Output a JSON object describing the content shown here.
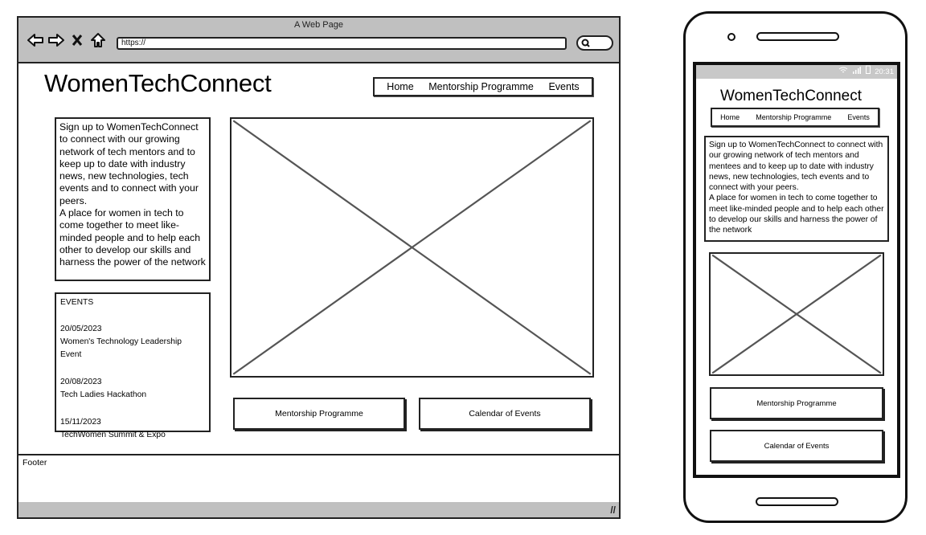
{
  "desktop": {
    "browser": {
      "window_title": "A Web Page",
      "url": "https://",
      "nav_icons": [
        "back-arrow-icon",
        "forward-arrow-icon",
        "close-x-icon",
        "home-icon"
      ],
      "search_icon": "search-icon"
    },
    "header": {
      "logo": "WomenTechConnect",
      "nav": [
        "Home",
        "Mentorship Programme",
        "Events"
      ]
    },
    "intro": {
      "paragraph1": "Sign up to WomenTechConnect to connect with our growing network of tech mentors and to keep up to date with industry news, new technologies, tech events and to connect with your peers.",
      "paragraph2": "A place for women in tech to come together to meet like-minded people and to help each other to develop our skills and harness the power of the network"
    },
    "events": {
      "heading": "EVENTS",
      "items": [
        {
          "date": "20/05/2023",
          "title": "Women's Technology Leadership Event"
        },
        {
          "date": "20/08/2023",
          "title": "Tech Ladies Hackathon"
        },
        {
          "date": "15/11/2023",
          "title": "TechWomen Summit & Expo"
        }
      ]
    },
    "hero_image": "image-placeholder",
    "buttons": [
      "Mentorship Programme",
      "Calendar of Events"
    ],
    "footer": "Footer"
  },
  "mobile": {
    "status_bar": {
      "time": "20:31",
      "icons": [
        "wifi-icon",
        "signal-icon",
        "battery-icon"
      ]
    },
    "header": {
      "logo": "WomenTechConnect",
      "nav": [
        "Home",
        "Mentorship Programme",
        "Events"
      ]
    },
    "intro": {
      "paragraph1": "Sign up to WomenTechConnect to connect with our growing network of tech mentors and mentees and to keep up to date with industry news, new technologies, tech events and to connect with your peers.",
      "paragraph2": "A place for women in tech to come together to meet like-minded people and to help each other to develop our skills and harness the power of the network"
    },
    "hero_image": "image-placeholder",
    "buttons": [
      "Mentorship Programme",
      "Calendar of Events"
    ]
  }
}
